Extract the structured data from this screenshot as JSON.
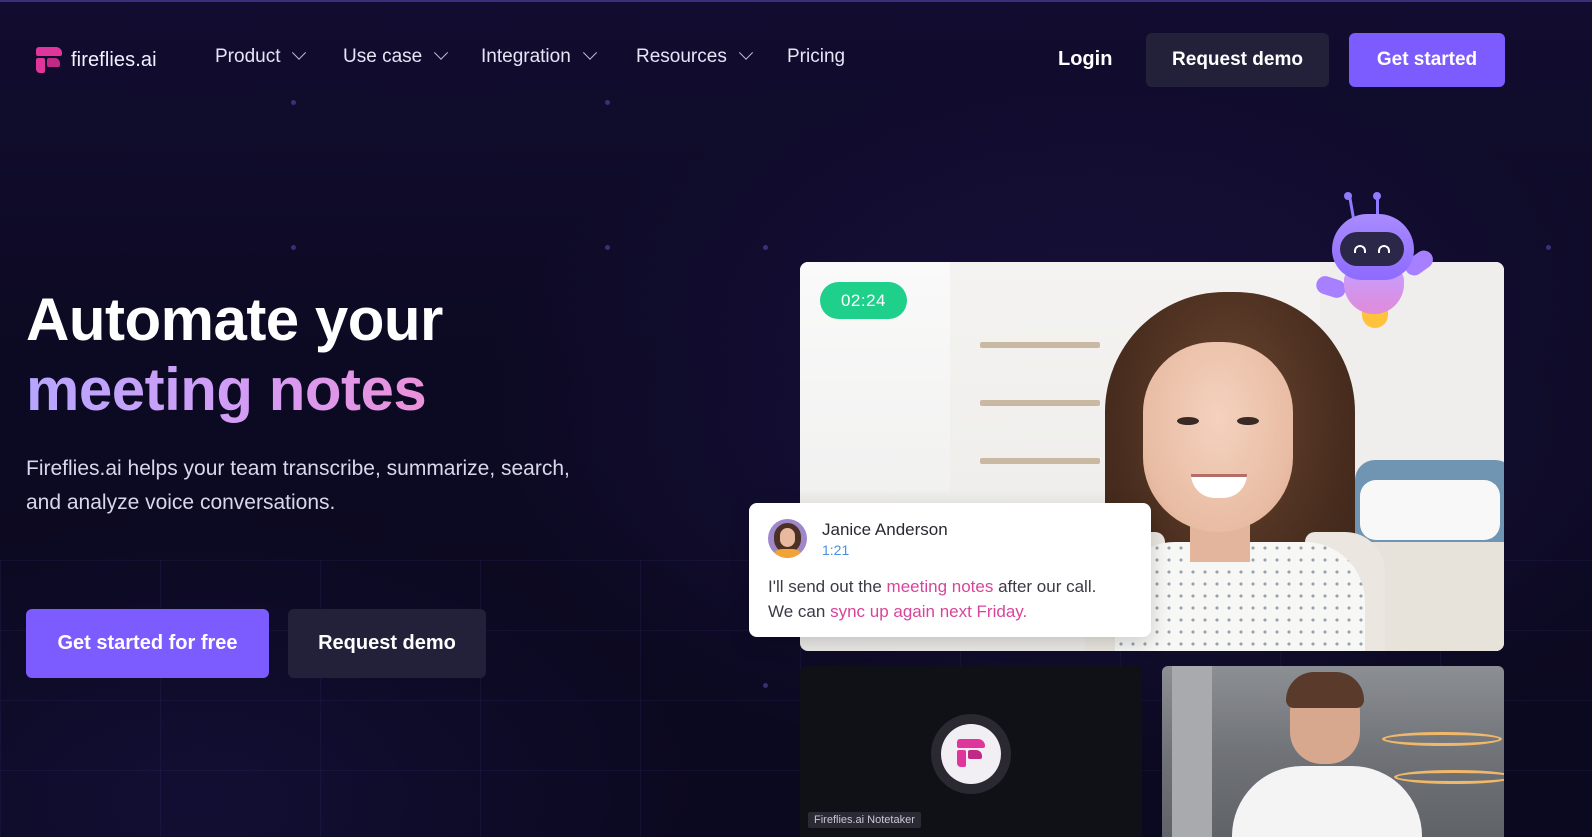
{
  "brand": {
    "name": "fireflies.ai",
    "accent": "#7c5cff",
    "logo_color": "#e0359a"
  },
  "nav": {
    "items": [
      {
        "label": "Product",
        "has_dropdown": true
      },
      {
        "label": "Use case",
        "has_dropdown": true
      },
      {
        "label": "Integration",
        "has_dropdown": true
      },
      {
        "label": "Resources",
        "has_dropdown": true
      },
      {
        "label": "Pricing",
        "has_dropdown": false
      }
    ],
    "login_label": "Login",
    "request_demo_label": "Request demo",
    "get_started_label": "Get started"
  },
  "hero": {
    "title_line1": "Automate your",
    "title_line2": "meeting notes",
    "subtitle": "Fireflies.ai helps your team transcribe, summarize, search, and analyze voice conversations.",
    "cta_primary": "Get started for free",
    "cta_secondary": "Request demo"
  },
  "video": {
    "timer": "02:24",
    "timer_color": "#1fd08a"
  },
  "transcript": {
    "speaker": "Janice Anderson",
    "timestamp": "1:21",
    "line1_a": "I'll send out the ",
    "line1_highlight": "meeting notes",
    "line1_b": " after our call.",
    "line2_a": "We can ",
    "line2_highlight": "sync up again next Friday.",
    "highlight_color": "#d7459b"
  },
  "tiles": {
    "notetaker_label": "Fireflies.ai Notetaker"
  }
}
